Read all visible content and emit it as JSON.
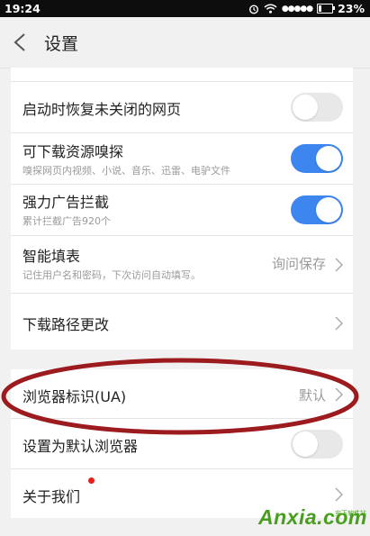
{
  "status_bar": {
    "time": "19:24",
    "signal": "●●●●●",
    "battery_percent": "23%"
  },
  "header": {
    "title": "设置"
  },
  "settings": {
    "restore_pages": {
      "title": "启动时恢复未关闭的网页",
      "enabled": false
    },
    "resource_sniff": {
      "title": "可下载资源嗅探",
      "subtitle": "嗅探网页内视频、小说、音乐、迅雷、电驴文件",
      "enabled": true
    },
    "ad_block": {
      "title": "强力广告拦截",
      "subtitle": "累计拦截广告920个",
      "enabled": true
    },
    "autofill": {
      "title": "智能填表",
      "subtitle": "记住用户名和密码，下次访问自动填写。",
      "value": "询问保存"
    },
    "download_path": {
      "title": "下载路径更改"
    },
    "user_agent": {
      "title": "浏览器标识(UA)",
      "value": "默认"
    },
    "default_browser": {
      "title": "设置为默认浏览器",
      "enabled": false
    },
    "about": {
      "title": "关于我们"
    }
  },
  "annotation": {
    "color": "#9b1b1f"
  },
  "watermark": {
    "text": "Anxia.com",
    "small": "安下软件站"
  },
  "colors": {
    "toggle_on": "#3d86f0",
    "toggle_off": "#e8e8e8",
    "badge": "#e61e1e"
  }
}
